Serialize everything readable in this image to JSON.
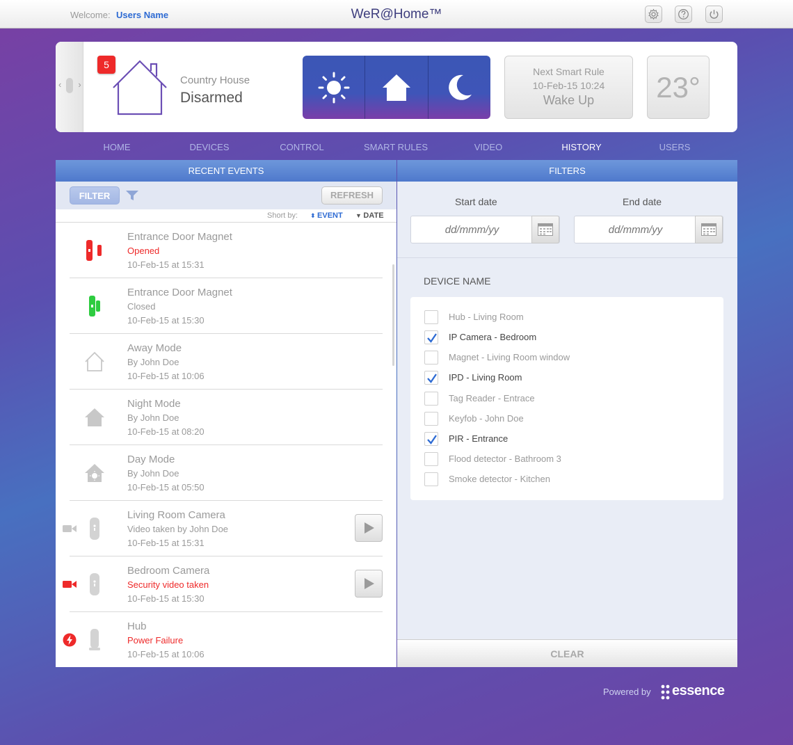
{
  "topbar": {
    "welcome_label": "Welcome:",
    "user_name": "Users Name",
    "brand": "WeR@Home™",
    "icons": [
      "gear-icon",
      "help-icon",
      "power-icon"
    ]
  },
  "header": {
    "alert_count": "5",
    "location_name": "Country House",
    "status": "Disarmed",
    "modes": [
      "day-mode",
      "home-mode",
      "night-mode"
    ],
    "smart_rule": {
      "title": "Next Smart Rule",
      "datetime": "10-Feb-15 10:24",
      "name": "Wake Up"
    },
    "temperature": "23°"
  },
  "nav": {
    "items": [
      {
        "label": "HOME"
      },
      {
        "label": "DEVICES"
      },
      {
        "label": "CONTROL"
      },
      {
        "label": "SMART RULES"
      },
      {
        "label": "VIDEO"
      },
      {
        "label": "HISTORY"
      },
      {
        "label": "USERS"
      }
    ],
    "active": "HISTORY"
  },
  "events_panel": {
    "title": "RECENT EVENTS",
    "filter_label": "FILTER",
    "refresh_label": "REFRESH",
    "sort_label": "Short by:",
    "sort_event": "EVENT",
    "sort_date": "DATE",
    "events": [
      {
        "title": "Entrance Door Magnet",
        "subtitle": "Opened",
        "time": "10-Feb-15 at 15:31",
        "icon": "magnet-open-icon",
        "alert": true
      },
      {
        "title": "Entrance Door Magnet",
        "subtitle": "Closed",
        "time": "10-Feb-15 at 15:30",
        "icon": "magnet-closed-icon",
        "alert": false
      },
      {
        "title": "Away Mode",
        "subtitle": "By John Doe",
        "time": "10-Feb-15 at 10:06",
        "icon": "away-house-icon",
        "alert": false
      },
      {
        "title": "Night Mode",
        "subtitle": "By John Doe",
        "time": "10-Feb-15 at 08:20",
        "icon": "night-house-icon",
        "alert": false
      },
      {
        "title": "Day Mode",
        "subtitle": "By John Doe",
        "time": "10-Feb-15 at 05:50",
        "icon": "day-house-icon",
        "alert": false
      },
      {
        "title": "Living Room Camera",
        "subtitle": "Video taken by  John Doe",
        "time": "10-Feb-15 at 15:31",
        "icon": "camera-device-icon",
        "alert": false
      },
      {
        "title": "Bedroom Camera",
        "subtitle": "Security video taken",
        "time": "10-Feb-15 at 15:30",
        "icon": "camera-device-icon",
        "alert": true
      },
      {
        "title": "Hub",
        "subtitle": "Power Failure",
        "time": "10-Feb-15 at 10:06",
        "icon": "hub-icon",
        "alert": true
      }
    ]
  },
  "filters_panel": {
    "title": "FILTERS",
    "start_label": "Start date",
    "end_label": "End date",
    "date_placeholder": "dd/mmm/yy",
    "device_heading": "DEVICE NAME",
    "devices": [
      {
        "name": "Hub - Living Room",
        "checked": false
      },
      {
        "name": "IP Camera - Bedroom",
        "checked": true
      },
      {
        "name": "Magnet - Living Room window",
        "checked": false
      },
      {
        "name": "IPD - Living Room",
        "checked": true
      },
      {
        "name": "Tag Reader - Entrace",
        "checked": false
      },
      {
        "name": "Keyfob - John Doe",
        "checked": false
      },
      {
        "name": "PIR - Entrance",
        "checked": true
      },
      {
        "name": "Flood detector - Bathroom 3",
        "checked": false
      },
      {
        "name": "Smoke detector - Kitchen",
        "checked": false
      }
    ],
    "clear_label": "CLEAR"
  },
  "footer": {
    "powered_by": "Powered by",
    "vendor": "essence"
  },
  "colors": {
    "accent_blue": "#2e6bd3",
    "alert_red": "#ee2a2a",
    "ok_green": "#2ecc40",
    "header_blue": "#5a82d0"
  }
}
